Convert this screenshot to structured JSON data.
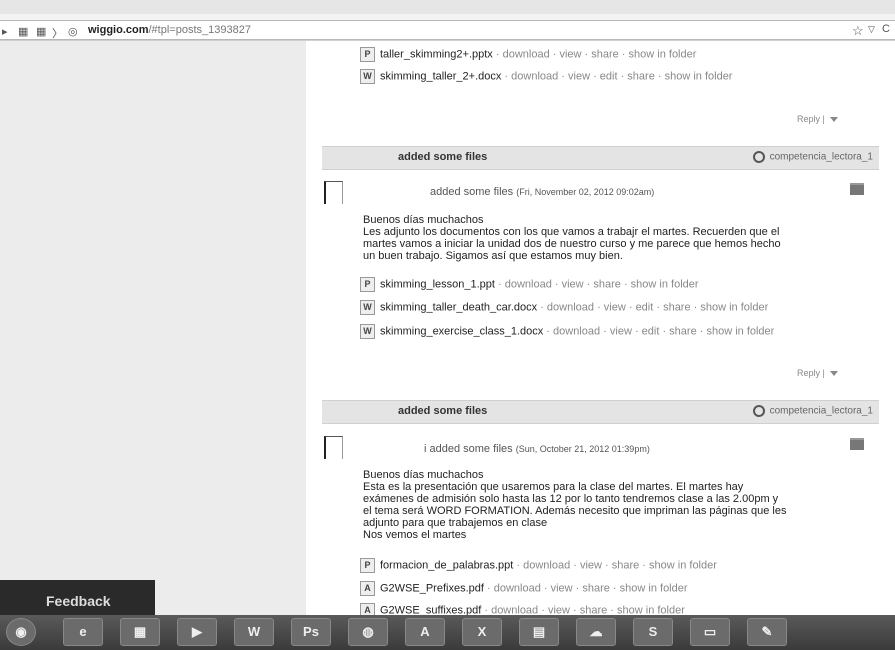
{
  "browser": {
    "url_domain": "wiggio.com",
    "url_path": "/#tpl=posts_1393827"
  },
  "prev_files": [
    {
      "icon": "P",
      "name": "taller_skimming2+.pptx",
      "actions": " · download · view · share · show in folder"
    },
    {
      "icon": "W",
      "name": "skimming_taller_2+.docx",
      "actions": " · download · view · edit · share · show in folder"
    }
  ],
  "reply_label": "Reply |",
  "posts": [
    {
      "header_title": "added some files",
      "group": "competencia_lectora_1",
      "meta_text": "added some files",
      "meta_date": "(Fri, November 02, 2012 09:02am)",
      "message": "Buenos días muchachos\nLes adjunto los documentos con los que vamos a trabajr el martes. Recuerden que el\nmartes vamos a iniciar la unidad dos de nuestro curso y me parece que hemos hecho\nun buen trabajo. Sigamos así que estamos muy bien.",
      "files": [
        {
          "icon": "P",
          "name": "skimming_lesson_1.ppt",
          "actions": " · download · view · share · show in folder"
        },
        {
          "icon": "W",
          "name": "skimming_taller_death_car.docx",
          "actions": " · download · view · edit · share · show in folder"
        },
        {
          "icon": "W",
          "name": "skimming_exercise_class_1.docx",
          "actions": " · download · view · edit · share · show in folder"
        }
      ]
    },
    {
      "header_title": "added some files",
      "group": "competencia_lectora_1",
      "meta_text": "i added some files",
      "meta_date": "(Sun, October 21, 2012 01:39pm)",
      "message": "Buenos días muchachos\nEsta es la presentación que usaremos para la clase del martes. El martes hay\nexámenes de admisión solo hasta las 12 por lo tanto tendremos clase a las 2.00pm y\nel tema será WORD FORMATION. Además necesito que impriman las páginas que les\nadjunto para que trabajemos en clase\nNos vemos el martes",
      "files": [
        {
          "icon": "P",
          "name": "formacion_de_palabras.ppt",
          "actions": " · download · view · share · show in folder"
        },
        {
          "icon": "A",
          "name": "G2WSE_Prefixes.pdf",
          "actions": " · download · view · share · show in folder"
        },
        {
          "icon": "A",
          "name": "G2WSE_suffixes.pdf",
          "actions": " · download · view · share · show in folder"
        }
      ]
    }
  ],
  "feedback_label": "Feedback",
  "taskbar": {
    "items": [
      {
        "icon": "start-orb-icon",
        "glyph": "◉"
      },
      {
        "icon": "internet-explorer-icon",
        "glyph": "e"
      },
      {
        "icon": "file-manager-icon",
        "glyph": "▦"
      },
      {
        "icon": "media-player-icon",
        "glyph": "▶"
      },
      {
        "icon": "word-icon",
        "glyph": "W"
      },
      {
        "icon": "photoshop-icon",
        "glyph": "Ps"
      },
      {
        "icon": "browser-icon",
        "glyph": "◍"
      },
      {
        "icon": "acrobat-icon",
        "glyph": "A"
      },
      {
        "icon": "excel-icon",
        "glyph": "X"
      },
      {
        "icon": "book-icon",
        "glyph": "▤"
      },
      {
        "icon": "cloud-icon",
        "glyph": "☁"
      },
      {
        "icon": "skype-icon",
        "glyph": "S"
      },
      {
        "icon": "folder-icon",
        "glyph": "▭"
      },
      {
        "icon": "paint-icon",
        "glyph": "✎"
      }
    ]
  }
}
